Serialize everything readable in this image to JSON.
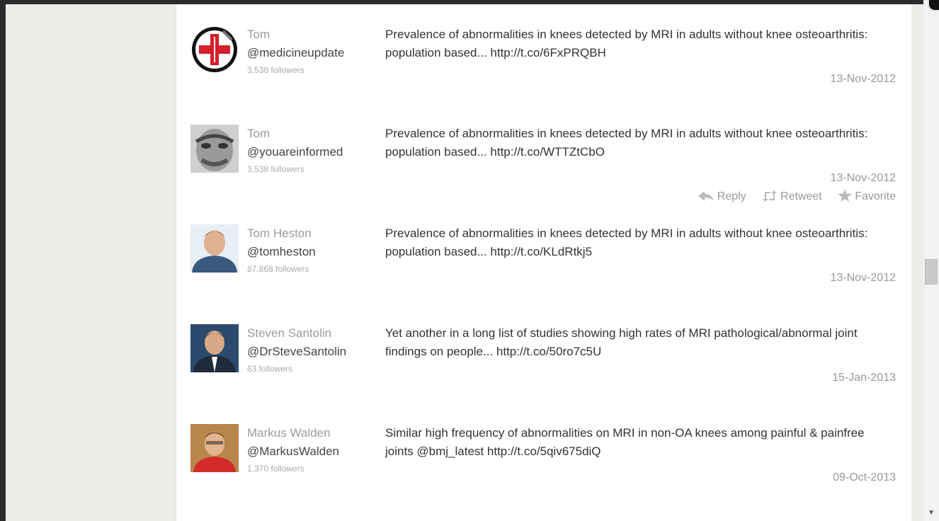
{
  "tweets": [
    {
      "name": "Tom",
      "handle": "@medicineupdate",
      "followers": "3,538 followers",
      "text": "Prevalence of abnormalities in knees detected by MRI in adults without knee osteoarthritis: population based... http://t.co/6FxPRQBH",
      "date": "13-Nov-2012",
      "avatar": "red-cross-logo"
    },
    {
      "name": "Tom",
      "handle": "@youareinformed",
      "followers": "3,538 followers",
      "text": "Prevalence of abnormalities in knees detected by MRI in adults without knee osteoarthritis: population based... http://t.co/WTTZtCbO",
      "date": "13-Nov-2012",
      "avatar": "statue-face"
    },
    {
      "name": "Tom Heston",
      "handle": "@tomheston",
      "followers": "87,868 followers",
      "text": "Prevalence of abnormalities in knees detected by MRI in adults without knee osteoarthritis: population based... http://t.co/KLdRtkj5",
      "date": "13-Nov-2012",
      "avatar": "person-photo"
    },
    {
      "name": "Steven Santolin",
      "handle": "@DrSteveSantolin",
      "followers": "63 followers",
      "text": "Yet another in a long list of studies showing high rates of MRI pathological/abnormal joint findings on people... http://t.co/50ro7c5U",
      "date": "15-Jan-2013",
      "avatar": "person-photo"
    },
    {
      "name": "Markus Walden",
      "handle": "@MarkusWalden",
      "followers": "1,370 followers",
      "text": "Similar high frequency of abnormalities on MRI in non-OA knees among painful & painfree joints @bmj_latest http://t.co/5qiv675diQ",
      "date": "09-Oct-2013",
      "avatar": "person-photo"
    }
  ],
  "actions": {
    "reply": "Reply",
    "retweet": "Retweet",
    "favorite": "Favorite"
  }
}
